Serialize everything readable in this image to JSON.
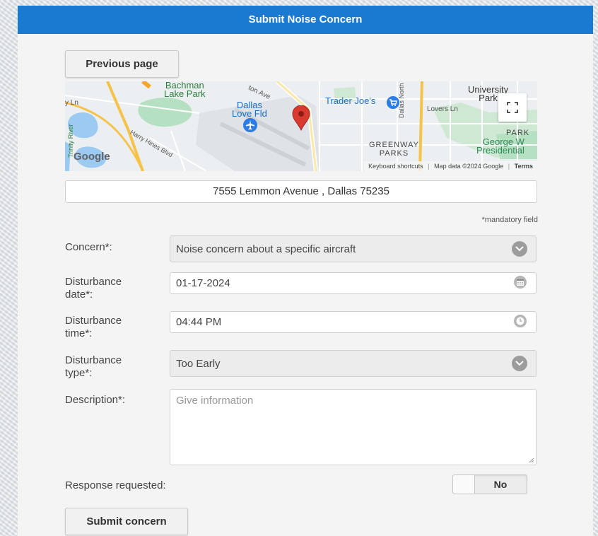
{
  "header": {
    "title": "Submit Noise Concern"
  },
  "nav": {
    "previous_label": "Previous page"
  },
  "map": {
    "labels": {
      "bachman_lake": "Bachman\nLake Park",
      "dallas_love_field": "Dallas\nLove Fld",
      "trader_joes": "Trader Joe's",
      "university_park": "University\nPark",
      "lovers_ln_left": "y Ln",
      "lovers_ln_right": "Lovers Ln",
      "dallas_north_tollway": "Dallas North T",
      "greenway_parks": "GREENWAY\nPARKS",
      "park": "PARK",
      "george_w": "George W\nPresidential",
      "harry_hines": "Harry Hines Blvd",
      "trinity_river": "Trinity River",
      "denton_ave": "ton Ave",
      "google": "Google"
    },
    "footer": {
      "shortcuts": "Keyboard shortcuts",
      "data": "Map data ©2024 Google",
      "terms": "Terms"
    },
    "icons": {
      "fullscreen": "fullscreen-icon",
      "pin": "map-pin-icon",
      "airport": "airport-icon"
    }
  },
  "location": {
    "address": "7555 Lemmon Avenue , Dallas 75235"
  },
  "form": {
    "mandatory_note": "*mandatory field",
    "concern": {
      "label": "Concern*:",
      "value": "Noise concern about a specific aircraft"
    },
    "date": {
      "label": "Disturbance\ndate*:",
      "value": "01-17-2024"
    },
    "time": {
      "label": "Disturbance\ntime*:",
      "value": "04:44 PM"
    },
    "type": {
      "label": "Disturbance\ntype*:",
      "value": "Too Early"
    },
    "description": {
      "label": "Description*:",
      "placeholder": "Give information",
      "value": ""
    },
    "response": {
      "label": "Response requested:",
      "toggle_label": "No",
      "enabled": false
    },
    "submit_label": "Submit concern"
  },
  "colors": {
    "header_bg": "#1a7ad1",
    "pin": "#d93a2f",
    "water": "#9ccaf0",
    "park": "#b6e0c2"
  }
}
